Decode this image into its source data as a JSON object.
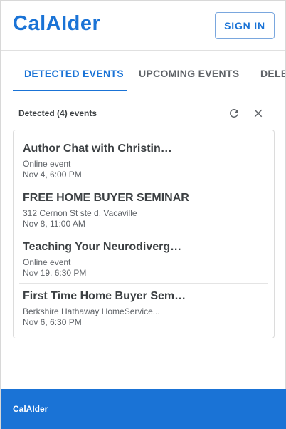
{
  "header": {
    "logo": "CalAIder",
    "sign_in_label": "SIGN IN"
  },
  "tabs": [
    {
      "label": "DETECTED EVENTS",
      "active": true
    },
    {
      "label": "UPCOMING EVENTS",
      "active": false
    },
    {
      "label": "DELETED EVENTS",
      "active": false
    }
  ],
  "list": {
    "title": "Detected (4) events",
    "refresh_icon": "refresh-icon",
    "close_icon": "close-icon"
  },
  "events": [
    {
      "title": "Author Chat with Christin…",
      "location": "Online event",
      "time": "Nov 4, 6:00 PM"
    },
    {
      "title": "FREE HOME BUYER SEMINAR",
      "location": "312 Cernon St ste d, Vacaville",
      "time": "Nov 8, 11:00 AM"
    },
    {
      "title": "Teaching Your Neurodiverg…",
      "location": "Online event",
      "time": "Nov 19, 6:30 PM"
    },
    {
      "title": "First Time Home Buyer Sem…",
      "location": "Berkshire Hathaway HomeService...",
      "time": "Nov 6, 6:30 PM"
    }
  ],
  "footer": {
    "text": "CalAIder"
  },
  "colors": {
    "accent": "#1a73d6",
    "text": "#3c4043",
    "muted": "#5f6368"
  }
}
